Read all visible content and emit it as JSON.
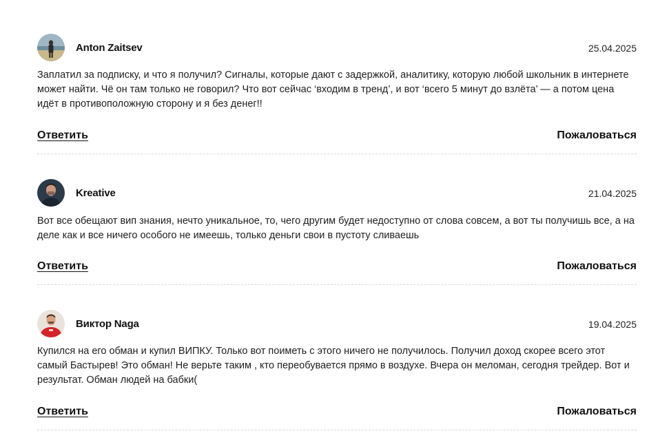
{
  "comments": [
    {
      "author": "Anton Zaitsev",
      "date": "25.04.2025",
      "text": "Заплатил за подписку, и что я получил? Сигналы, которые дают с задержкой, аналитику, которую любой школьник в интернете может найти. Чё он там только не говорил? Что вот сейчас ‘входим в тренд’, и вот ‘всего 5 минут до взлёта’ — а потом цена идёт в противоположную сторону и я без денег!!",
      "reply_label": "Ответить",
      "report_label": "Пожаловаться"
    },
    {
      "author": "Kreative",
      "date": "21.04.2025",
      "text": "Вот все обещают вип знания, нечто уникальное, то, чего другим будет недоступно от слова совсем, а вот ты получишь все, а на деле как и все ничего особого не имеешь, только деньги свои в пустоту сливаешь",
      "reply_label": "Ответить",
      "report_label": "Пожаловаться"
    },
    {
      "author": "Виктор Naga",
      "date": "19.04.2025",
      "text": "Купился на его обман и купил ВИПКУ. Только вот поиметь с этого ничего не получилось. Получил доход скорее всего этот самый Бастырев! Это обман! Не верьте таким , кто переобувается прямо в воздухе. Вчера он меломан, сегодня трейдер. Вот и результат. Обман людей на бабки(",
      "reply_label": "Ответить",
      "report_label": "Пожаловаться"
    }
  ]
}
